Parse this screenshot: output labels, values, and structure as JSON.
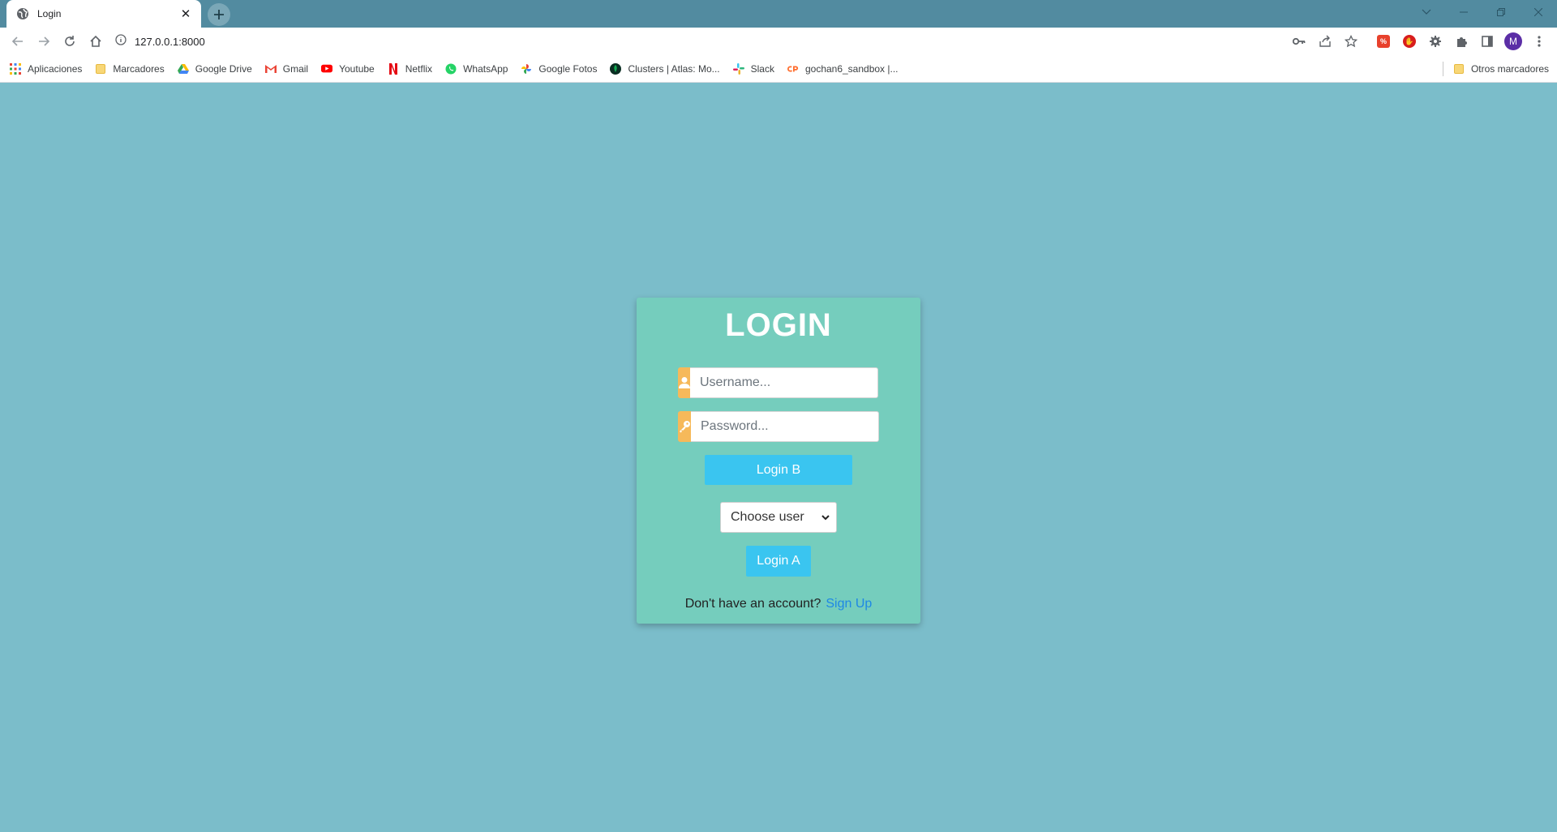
{
  "browser": {
    "tab_title": "Login",
    "url": "127.0.0.1:8000",
    "bookmarks": [
      {
        "label": "Aplicaciones",
        "icon": "apps-grid-icon"
      },
      {
        "label": "Marcadores",
        "icon": "folder-icon"
      },
      {
        "label": "Google Drive",
        "icon": "google-drive-icon"
      },
      {
        "label": "Gmail",
        "icon": "gmail-icon"
      },
      {
        "label": "Youtube",
        "icon": "youtube-icon"
      },
      {
        "label": "Netflix",
        "icon": "netflix-icon"
      },
      {
        "label": "WhatsApp",
        "icon": "whatsapp-icon"
      },
      {
        "label": "Google Fotos",
        "icon": "google-photos-icon"
      },
      {
        "label": "Clusters | Atlas: Mo...",
        "icon": "mongodb-leaf-icon"
      },
      {
        "label": "Slack",
        "icon": "slack-icon"
      },
      {
        "label": "gochan6_sandbox |...",
        "icon": "cpanel-icon"
      }
    ],
    "other_bookmarks": "Otros marcadores",
    "profile_initial": "M"
  },
  "login": {
    "title": "LOGIN",
    "username_placeholder": "Username...",
    "password_placeholder": "Password...",
    "login_b_label": "Login B",
    "select_value": "Choose user",
    "login_a_label": "Login A",
    "no_account_text": "Don't have an account?",
    "signup_label": "Sign Up"
  },
  "colors": {
    "page_bg": "#7bbdca",
    "card_bg": "#75cdbd",
    "addon": "#f6b95a",
    "button": "#3ac5f0",
    "link": "#1e88e5"
  }
}
